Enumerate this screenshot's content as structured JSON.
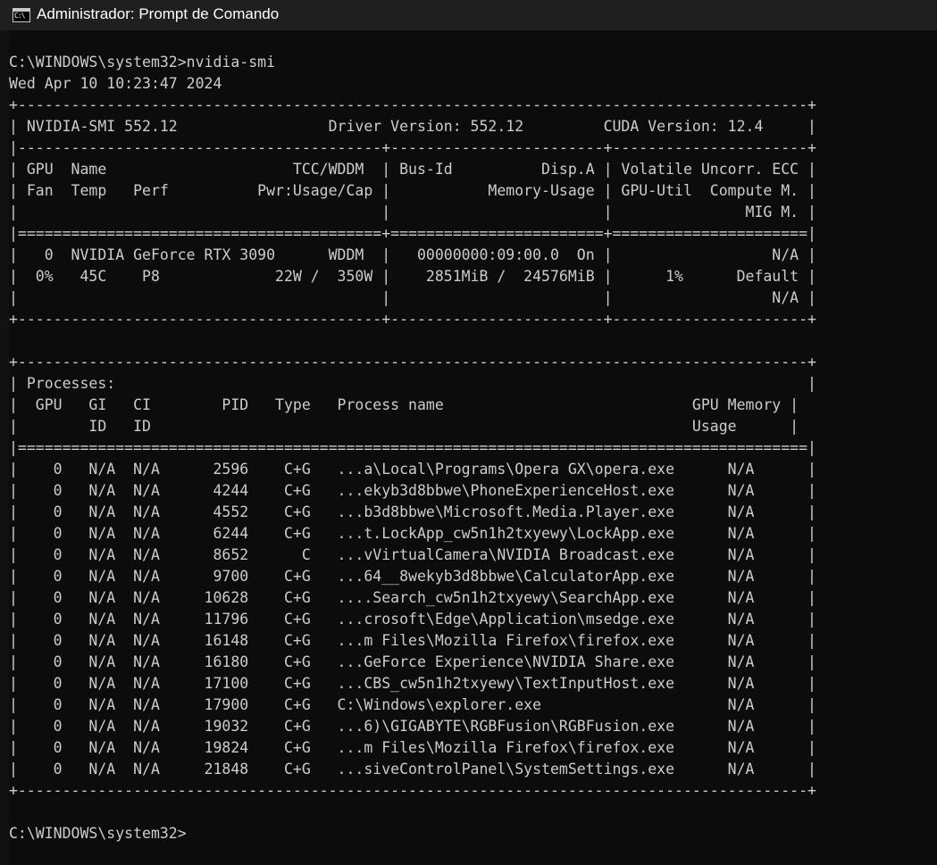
{
  "window": {
    "title": "Administrador: Prompt de Comando",
    "icon": "cmd-icon",
    "icon_glyph": "C:\\"
  },
  "console": {
    "lines": [
      "C:\\WINDOWS\\system32>nvidia-smi",
      "Wed Apr 10 10:23:47 2024",
      "+-----------------------------------------------------------------------------------------+",
      "| NVIDIA-SMI 552.12                 Driver Version: 552.12         CUDA Version: 12.4     |",
      "|-----------------------------------------+------------------------+----------------------+",
      "| GPU  Name                     TCC/WDDM  | Bus-Id          Disp.A | Volatile Uncorr. ECC |",
      "| Fan  Temp   Perf          Pwr:Usage/Cap |           Memory-Usage | GPU-Util  Compute M. |",
      "|                                         |                        |               MIG M. |",
      "|=========================================+========================+======================|",
      "|   0  NVIDIA GeForce RTX 3090      WDDM  |   00000000:09:00.0  On |                  N/A |",
      "|  0%   45C    P8             22W /  350W |    2851MiB /  24576MiB |      1%      Default |",
      "|                                         |                        |                  N/A |",
      "+-----------------------------------------+------------------------+----------------------+",
      "",
      "+-----------------------------------------------------------------------------------------+",
      "| Processes:                                                                              |",
      "|  GPU   GI   CI        PID   Type   Process name                            GPU Memory |",
      "|        ID   ID                                                             Usage      |",
      "|=========================================================================================|",
      "|    0   N/A  N/A      2596    C+G   ...a\\Local\\Programs\\Opera GX\\opera.exe      N/A      |",
      "|    0   N/A  N/A      4244    C+G   ...ekyb3d8bbwe\\PhoneExperienceHost.exe      N/A      |",
      "|    0   N/A  N/A      4552    C+G   ...b3d8bbwe\\Microsoft.Media.Player.exe      N/A      |",
      "|    0   N/A  N/A      6244    C+G   ...t.LockApp_cw5n1h2txyewy\\LockApp.exe      N/A      |",
      "|    0   N/A  N/A      8652      C   ...vVirtualCamera\\NVIDIA Broadcast.exe      N/A      |",
      "|    0   N/A  N/A      9700    C+G   ...64__8wekyb3d8bbwe\\CalculatorApp.exe      N/A      |",
      "|    0   N/A  N/A     10628    C+G   ....Search_cw5n1h2txyewy\\SearchApp.exe      N/A      |",
      "|    0   N/A  N/A     11796    C+G   ...crosoft\\Edge\\Application\\msedge.exe      N/A      |",
      "|    0   N/A  N/A     16148    C+G   ...m Files\\Mozilla Firefox\\firefox.exe      N/A      |",
      "|    0   N/A  N/A     16180    C+G   ...GeForce Experience\\NVIDIA Share.exe      N/A      |",
      "|    0   N/A  N/A     17100    C+G   ...CBS_cw5n1h2txyewy\\TextInputHost.exe      N/A      |",
      "|    0   N/A  N/A     17900    C+G   C:\\Windows\\explorer.exe                     N/A      |",
      "|    0   N/A  N/A     19032    C+G   ...6)\\GIGABYTE\\RGBFusion\\RGBFusion.exe      N/A      |",
      "|    0   N/A  N/A     19824    C+G   ...m Files\\Mozilla Firefox\\firefox.exe      N/A      |",
      "|    0   N/A  N/A     21848    C+G   ...siveControlPanel\\SystemSettings.exe      N/A      |",
      "+-----------------------------------------------------------------------------------------+",
      "",
      "C:\\WINDOWS\\system32>"
    ]
  }
}
